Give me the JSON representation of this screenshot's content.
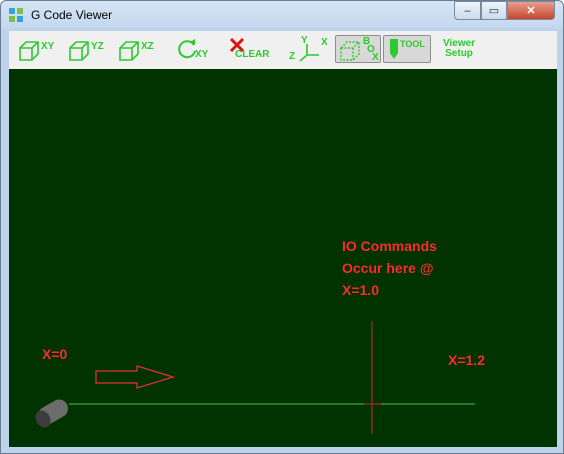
{
  "window": {
    "title": "G Code Viewer",
    "controls": {
      "minimize": "–",
      "maximize": "▭",
      "close": "✕"
    }
  },
  "toolbar": {
    "view_xy": "XY",
    "view_yz": "YZ",
    "view_xz": "XZ",
    "rotate_xy": "XY",
    "clear": "CLEAR",
    "axes_y": "Y",
    "axes_x": "X",
    "axes_z": "Z",
    "box_b": "B",
    "box_o": "O",
    "box_x": "X",
    "tool": "TOOL",
    "viewer_setup": [
      "Viewer",
      "Setup"
    ]
  },
  "viewport": {
    "io_note": [
      "IO Commands",
      "Occur here @",
      "X=1.0"
    ],
    "x_start": "X=0",
    "x_end": "X=1.2"
  },
  "colors": {
    "viewport_bg": "#003300",
    "accent_green": "#2ec92e",
    "annotation_red": "#ff2a2a",
    "path_green": "#49c549"
  }
}
